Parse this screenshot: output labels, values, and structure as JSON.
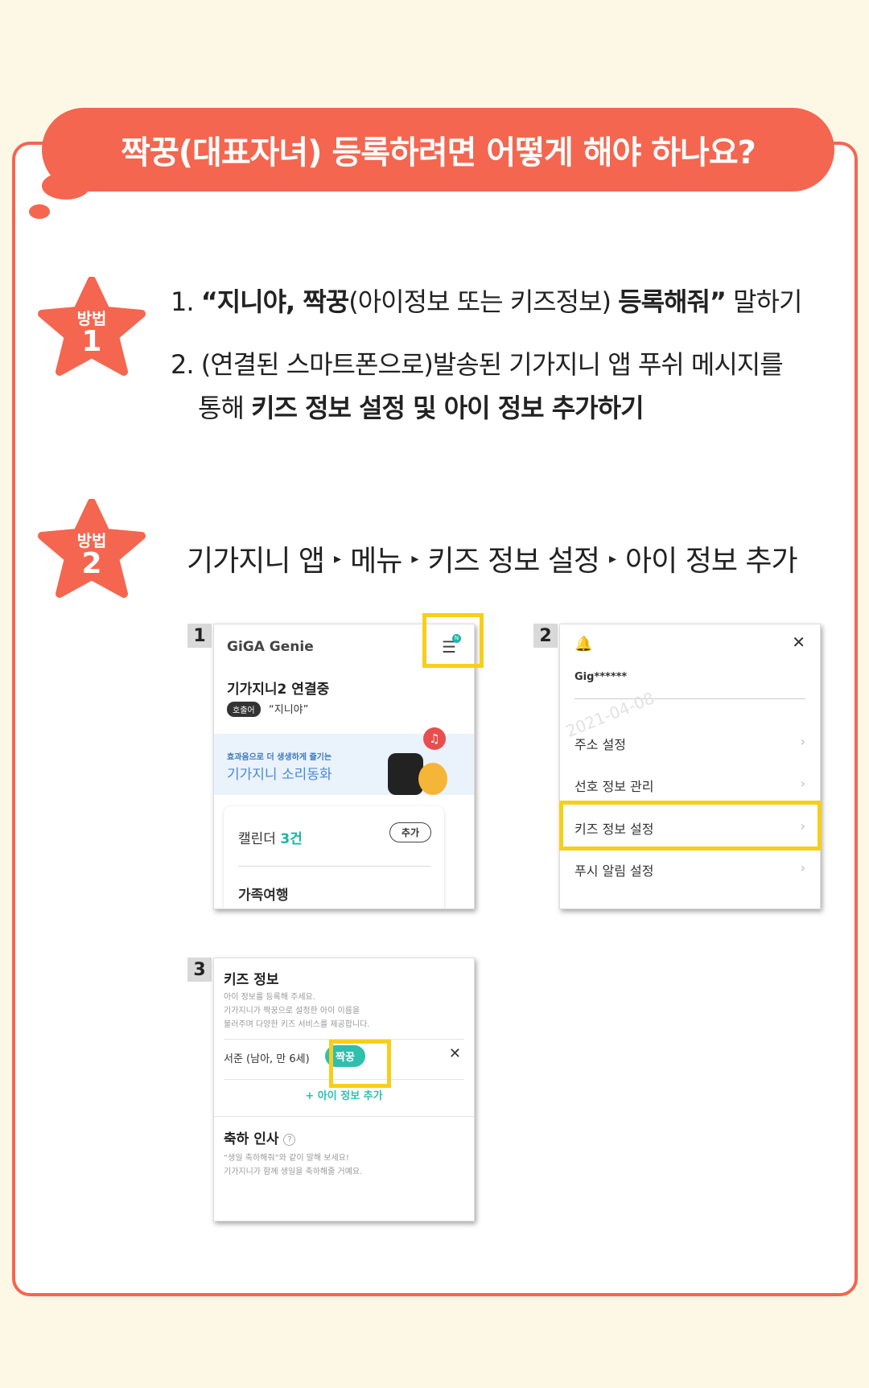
{
  "header": {
    "title": "짝꿍(대표자녀) 등록하려면 어떻게 해야 하나요?"
  },
  "colors": {
    "accent": "#f4664f",
    "highlight": "#f6cf1a",
    "teal": "#2ebfad",
    "background": "#fdf8e6"
  },
  "method1": {
    "badge_word": "방법",
    "badge_num": "1",
    "step1": {
      "prefix": "1. ",
      "bold1": "“지니야, 짝꿍",
      "normal1": "(아이정보 또는 키즈정보) ",
      "bold2": "등록해줘”",
      "normal2": " 말하기"
    },
    "step2": {
      "line1": "2. (연결된 스마트폰으로)발송된 기가지니 앱 푸쉬 메시지를",
      "prefix": "통해 ",
      "bold": "키즈 정보 설정 및 아이 정보 추가하기"
    }
  },
  "method2": {
    "badge_word": "방법",
    "badge_num": "2",
    "path": [
      "기가지니 앱",
      "메뉴",
      "키즈 정보 설정",
      "아이 정보 추가"
    ],
    "arrow": "▸"
  },
  "screen1": {
    "num": "1",
    "brand": "GiGA Genie",
    "menu_icon": "☰",
    "badge": "N",
    "connected": "기가지니2 연결중",
    "call_chip": "호출어",
    "call_word": "“지니야”",
    "banner_small": "효과음으로 더 생생하게 즐기는",
    "banner_big": "기가지니 소리동화",
    "music_icon": "♫",
    "calendar_label": "캘린더",
    "calendar_count": "3건",
    "add_button": "추가",
    "event": "가족여행"
  },
  "screen2": {
    "num": "2",
    "bell_icon": "🔔",
    "close_icon": "✕",
    "user": "Gig******",
    "watermark": "2021-04-08",
    "items": [
      {
        "label": "주소 설정"
      },
      {
        "label": "선호 정보 관리"
      },
      {
        "label": "키즈 정보 설정"
      },
      {
        "label": "푸시 알림 설정"
      }
    ],
    "chevron": "›"
  },
  "screen3": {
    "num": "3",
    "title": "키즈 정보",
    "desc": [
      "아이 정보를 등록해 주세요.",
      "기가지니가 짝꿍으로 설정한 아이 이름을",
      "불러주며 다양한 키즈 서비스를 제공합니다."
    ],
    "child": "서준 (남아, 만 6세)",
    "partner_badge": "짝꿍",
    "remove_icon": "✕",
    "add_child": "+ 아이 정보 추가",
    "greeting_title": "축하 인사",
    "help_icon": "?",
    "greeting_desc": [
      "“생일 축하해줘”와 같이 말해 보세요!",
      "기가지니가 함께 생일을 축하해줄 거예요."
    ]
  }
}
